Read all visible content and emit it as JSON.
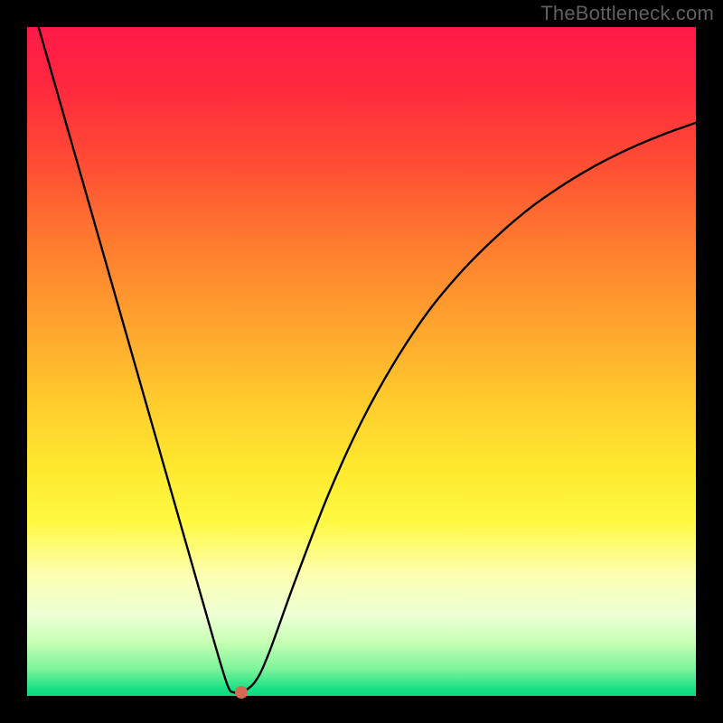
{
  "watermark": "TheBottleneck.com",
  "chart_data": {
    "type": "line",
    "title": "",
    "xlabel": "",
    "ylabel": "",
    "xlim": [
      0,
      100
    ],
    "ylim": [
      0,
      100
    ],
    "series": [
      {
        "name": "curve",
        "x": [
          0,
          5,
          10,
          15,
          20,
          25,
          28,
          30,
          31,
          32,
          34,
          36,
          40,
          45,
          50,
          55,
          60,
          65,
          70,
          75,
          80,
          85,
          90,
          95,
          100
        ],
        "values": [
          106,
          88.5,
          71,
          53.5,
          36,
          18.5,
          8,
          1.5,
          0.5,
          0.5,
          2,
          6,
          17,
          30,
          41,
          50,
          57.5,
          63.5,
          68.5,
          72.8,
          76.3,
          79.3,
          81.8,
          83.9,
          85.7
        ]
      }
    ],
    "marker": {
      "x": 32,
      "y": 0.5
    },
    "background_gradient": {
      "top": "#ff1a48",
      "mid": "#ffe92f",
      "bottom": "#0ed980"
    }
  }
}
